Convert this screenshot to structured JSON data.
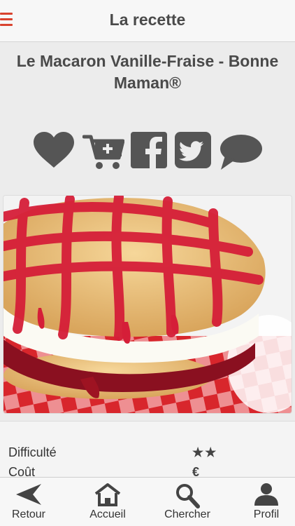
{
  "header": {
    "title": "La recette",
    "menu_icon": "hamburger-menu-icon",
    "accent_color": "#d9432f"
  },
  "recipe": {
    "title_line1": "Le Macaron Vanille-Fraise - Bonne",
    "title_line2": "Maman®"
  },
  "actions": [
    {
      "icon": "heart-icon"
    },
    {
      "icon": "add-to-cart-icon"
    },
    {
      "icon": "facebook-icon"
    },
    {
      "icon": "twitter-icon"
    },
    {
      "icon": "comment-icon"
    }
  ],
  "details": {
    "difficulty_label": "Difficulté",
    "difficulty_value": "★★",
    "cost_label": "Coût",
    "cost_value": "€"
  },
  "tabbar": {
    "back": "Retour",
    "home": "Accueil",
    "search": "Chercher",
    "profile": "Profil"
  },
  "colors": {
    "icon_gray": "#555555",
    "background": "#ececec"
  }
}
